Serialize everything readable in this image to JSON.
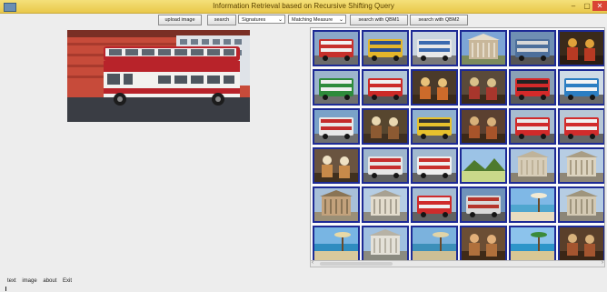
{
  "window": {
    "title": "Information Retrieval based on Recursive Shifting Query",
    "minimize_glyph": "–",
    "maximize_glyph": "▢",
    "close_glyph": "✕"
  },
  "toolbar": {
    "upload_label": "upload image",
    "search_label": "search",
    "signatures_value": "Signatures",
    "matching_value": "Matching Measure",
    "search_qbm1_label": "search with QBM1",
    "search_qbm2_label": "search with QBM2",
    "chevron_glyph": "⌄"
  },
  "query_image": {
    "subject": "red and white double-decker bus"
  },
  "results": [
    {
      "subject": "bus",
      "sky": "#8aa7c8",
      "ground": "#6b6b6b",
      "main": "#c7302c",
      "accent": "#f2f2f2"
    },
    {
      "subject": "bus",
      "sky": "#9ab4cf",
      "ground": "#5e5e5e",
      "main": "#e3b52b",
      "accent": "#2a4c8c"
    },
    {
      "subject": "bus",
      "sky": "#c9d4de",
      "ground": "#7a7a7a",
      "main": "#e8e8e8",
      "accent": "#3b6ab0"
    },
    {
      "subject": "building",
      "sky": "#7da5d6",
      "ground": "#7b8b5c",
      "main": "#c8b79a",
      "accent": "#e5dccb"
    },
    {
      "subject": "bus",
      "sky": "#6f8fb3",
      "ground": "#555",
      "main": "#4d6f9b",
      "accent": "#d8d8d8"
    },
    {
      "subject": "people",
      "sky": "#3a2a1a",
      "ground": "#2a1c12",
      "main": "#b83a23",
      "accent": "#e0a23a"
    },
    {
      "subject": "bus",
      "sky": "#9db4cc",
      "ground": "#6e6e6e",
      "main": "#2e8b3c",
      "accent": "#efefef"
    },
    {
      "subject": "bus",
      "sky": "#b3c6d6",
      "ground": "#555",
      "main": "#cc2b28",
      "accent": "#f0f0f0"
    },
    {
      "subject": "people",
      "sky": "#4a3a2a",
      "ground": "#3a2a1a",
      "main": "#cc6b2b",
      "accent": "#e8c27a"
    },
    {
      "subject": "people",
      "sky": "#5a4a3a",
      "ground": "#3a2a1a",
      "main": "#a8362c",
      "accent": "#d9c08a"
    },
    {
      "subject": "bus",
      "sky": "#8aa0b5",
      "ground": "#5a5a5a",
      "main": "#d42a2a",
      "accent": "#222"
    },
    {
      "subject": "bus",
      "sky": "#cfdbe6",
      "ground": "#6a6a6a",
      "main": "#2c7ec2",
      "accent": "#f4f4f4"
    },
    {
      "subject": "bus",
      "sky": "#7aa2c8",
      "ground": "#6f6f6f",
      "main": "#e8e8e8",
      "accent": "#c42b2b"
    },
    {
      "subject": "people",
      "sky": "#57462f",
      "ground": "#3e2f20",
      "main": "#8c5a32",
      "accent": "#ead7b0"
    },
    {
      "subject": "bus",
      "sky": "#8fb1cf",
      "ground": "#626262",
      "main": "#e7c12d",
      "accent": "#333"
    },
    {
      "subject": "people",
      "sky": "#5b4030",
      "ground": "#3b2818",
      "main": "#a8542a",
      "accent": "#d8b07a"
    },
    {
      "subject": "bus",
      "sky": "#a7bdd0",
      "ground": "#5d5d5d",
      "main": "#d02a2a",
      "accent": "#eaeaea"
    },
    {
      "subject": "bus",
      "sky": "#b8c8d6",
      "ground": "#666",
      "main": "#d12c2c",
      "accent": "#f1f1f1"
    },
    {
      "subject": "people",
      "sky": "#6a5440",
      "ground": "#40301e",
      "main": "#c78a4a",
      "accent": "#efe1c4"
    },
    {
      "subject": "bus",
      "sky": "#9fb6cc",
      "ground": "#5f5f5f",
      "main": "#e6e6e6",
      "accent": "#c62e2e"
    },
    {
      "subject": "bus",
      "sky": "#a2b9cf",
      "ground": "#646464",
      "main": "#f0f0f0",
      "accent": "#c8302c"
    },
    {
      "subject": "landscape",
      "sky": "#9cc3e6",
      "ground": "#5f8a3a",
      "main": "#4e7a2e",
      "accent": "#c9d98a"
    },
    {
      "subject": "building",
      "sky": "#a9c4df",
      "ground": "#8a8270",
      "main": "#d7cdb8",
      "accent": "#bfb39a"
    },
    {
      "subject": "building",
      "sky": "#b7cde3",
      "ground": "#8f8777",
      "main": "#dcd3bf",
      "accent": "#a99d84"
    },
    {
      "subject": "building",
      "sky": "#a8c0d8",
      "ground": "#9b8f76",
      "main": "#c3a27c",
      "accent": "#8a7455"
    },
    {
      "subject": "building",
      "sky": "#b5cde4",
      "ground": "#8d8a80",
      "main": "#e3dccd",
      "accent": "#a8a192"
    },
    {
      "subject": "bus",
      "sky": "#a5bdd2",
      "ground": "#626262",
      "main": "#cf2b2b",
      "accent": "#f0f0f0"
    },
    {
      "subject": "bus",
      "sky": "#6f93b9",
      "ground": "#5a5a5a",
      "main": "#d9d9d9",
      "accent": "#b5352b"
    },
    {
      "subject": "beach",
      "sky": "#7fb8e6",
      "ground": "#e8dcc0",
      "main": "#4fa6cf",
      "accent": "#f2ead3"
    },
    {
      "subject": "building",
      "sky": "#b6cde3",
      "ground": "#8c8678",
      "main": "#d3c9b3",
      "accent": "#9f957d"
    },
    {
      "subject": "beach",
      "sky": "#78b5e3",
      "ground": "#d9c99c",
      "main": "#2f8cc0",
      "accent": "#e8d9a6"
    },
    {
      "subject": "building",
      "sky": "#9fc0e0",
      "ground": "#8a8a80",
      "main": "#e4e1d8",
      "accent": "#b7b2a5"
    },
    {
      "subject": "beach",
      "sky": "#7bb2dd",
      "ground": "#cdbf95",
      "main": "#3c8fb9",
      "accent": "#e1d4a8"
    },
    {
      "subject": "people",
      "sky": "#6b4e34",
      "ground": "#3f2a18",
      "main": "#b0703c",
      "accent": "#e2b07a"
    },
    {
      "subject": "beach",
      "sky": "#8cc3ec",
      "ground": "#d8c794",
      "main": "#2d95c9",
      "accent": "#3b8a3a"
    },
    {
      "subject": "people",
      "sky": "#5a3f2a",
      "ground": "#3a2616",
      "main": "#a4552f",
      "accent": "#d9b27c"
    }
  ],
  "menu": {
    "text_label": "text",
    "image_label": "image",
    "about_label": "about",
    "exit_label": "Exit"
  }
}
